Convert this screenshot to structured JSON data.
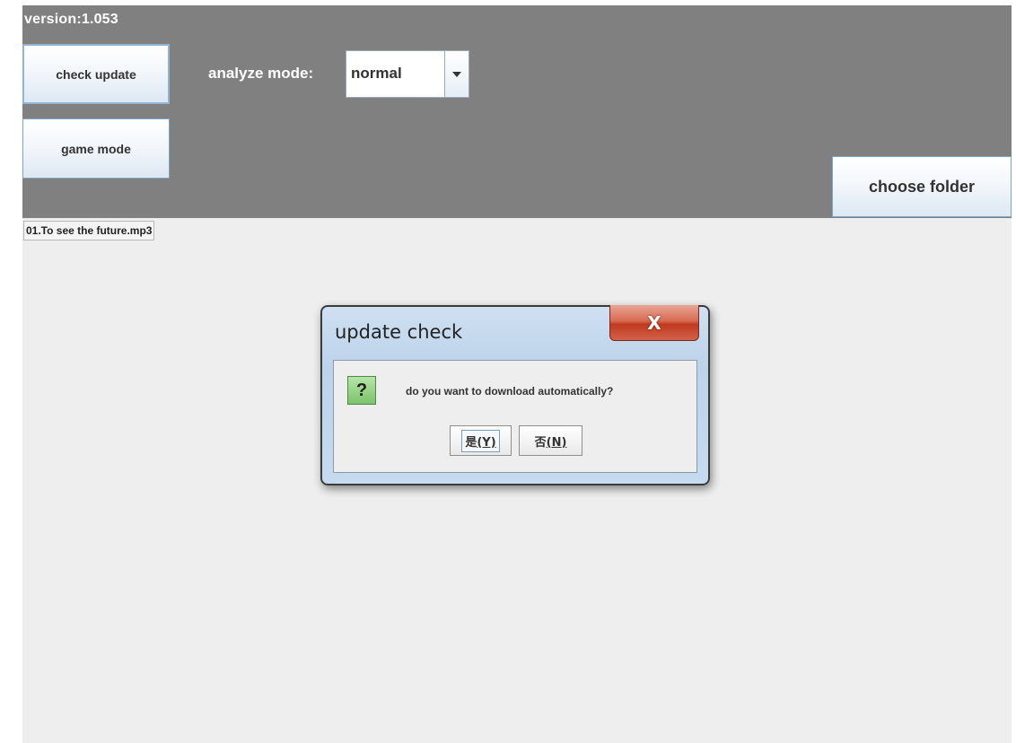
{
  "header": {
    "version_label": "version:1.053",
    "check_update_label": "check update",
    "game_mode_label": "game mode",
    "choose_folder_label": "choose folder",
    "analyze_mode_label": "analyze mode:",
    "analyze_mode_value": "normal"
  },
  "file_list": {
    "items": [
      "01.To see the future.mp3"
    ]
  },
  "dialog": {
    "title": "update check",
    "close_glyph": "X",
    "icon_glyph": "?",
    "message": "do you want to download automatically?",
    "yes_text": "是",
    "yes_mnemonic": "(Y)",
    "no_text": "否",
    "no_mnemonic": "(N)"
  },
  "colors": {
    "top_panel": "#808080",
    "content_background": "#eeeeee",
    "dialog_frame": "#bcd3ea",
    "close_button": "#c0391f",
    "question_icon": "#7cc36b"
  },
  "icons": {
    "combo_arrow": "chevron-down-icon",
    "close": "close-icon",
    "question": "question-icon"
  }
}
